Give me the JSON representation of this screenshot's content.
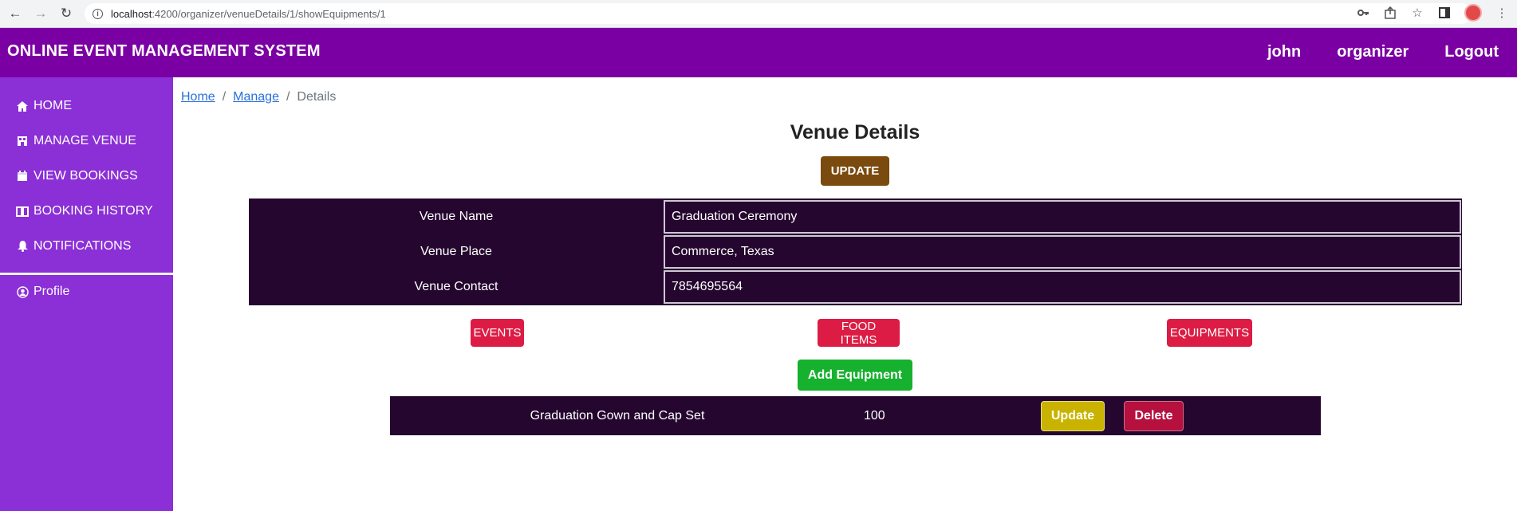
{
  "browser": {
    "url_host": "localhost",
    "url_path": ":4200/organizer/venueDetails/1/showEquipments/1"
  },
  "header": {
    "title": "ONLINE EVENT MANAGEMENT SYSTEM",
    "user": "john",
    "role": "organizer",
    "logout": "Logout",
    "color": "#7b00a3"
  },
  "sidebar": {
    "color": "#8b2fd6",
    "items": [
      {
        "label": "HOME",
        "icon": "home-icon"
      },
      {
        "label": "MANAGE VENUE",
        "icon": "building-icon"
      },
      {
        "label": "VIEW BOOKINGS",
        "icon": "calendar-icon"
      },
      {
        "label": "BOOKING HISTORY",
        "icon": "book-icon"
      },
      {
        "label": "NOTIFICATIONS",
        "icon": "bell-icon"
      }
    ],
    "profile": {
      "label": "Profile",
      "icon": "user-circle-icon"
    }
  },
  "breadcrumb": {
    "home": "Home",
    "manage": "Manage",
    "current": "Details"
  },
  "main": {
    "title": "Venue Details",
    "update_button": "UPDATE",
    "details": {
      "venue_name_label": "Venue Name",
      "venue_name": "Graduation  Ceremony",
      "venue_place_label": "Venue Place",
      "venue_place": "Commerce, Texas",
      "venue_contact_label": "Venue Contact",
      "venue_contact": "7854695564"
    },
    "categories": {
      "events": "EVENTS",
      "food_items": "FOOD ITEMS",
      "equipments": "EQUIPMENTS"
    },
    "add_equipment": "Add Equipment",
    "equipment": {
      "name": "Graduation Gown and Cap Set",
      "quantity": "100",
      "update": "Update",
      "delete": "Delete"
    }
  }
}
